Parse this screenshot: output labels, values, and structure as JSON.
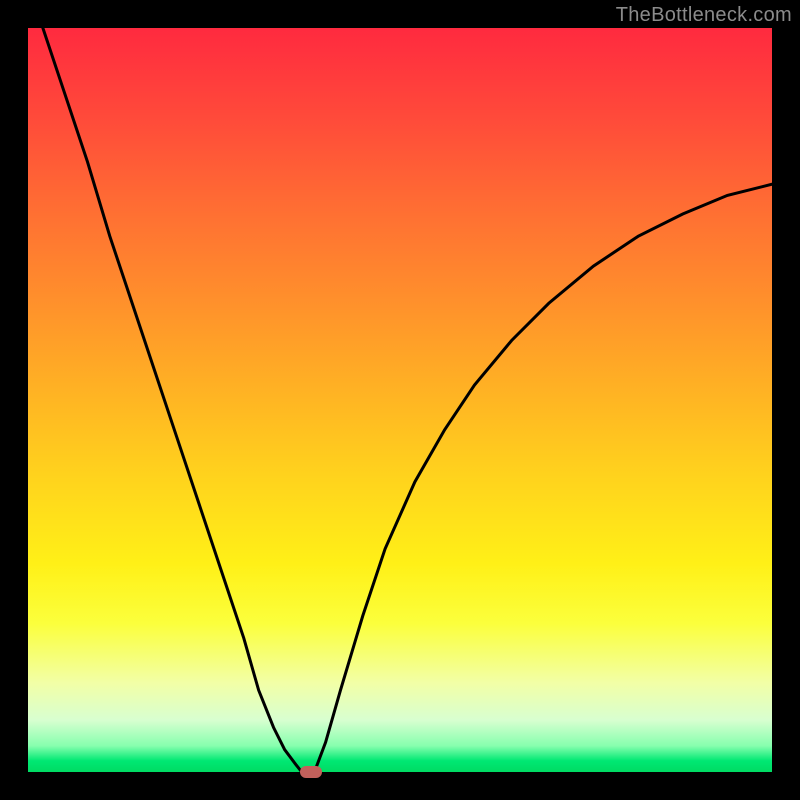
{
  "watermark": "TheBottleneck.com",
  "chart_data": {
    "type": "line",
    "title": "",
    "xlabel": "",
    "ylabel": "",
    "xlim": [
      0,
      100
    ],
    "ylim": [
      0,
      100
    ],
    "series": [
      {
        "name": "left-branch",
        "x": [
          2,
          5,
          8,
          11,
          14,
          17,
          20,
          23,
          26,
          29,
          31,
          33,
          34.5,
          36,
          36.8
        ],
        "y": [
          100,
          91,
          82,
          72,
          63,
          54,
          45,
          36,
          27,
          18,
          11,
          6,
          3,
          1,
          0
        ]
      },
      {
        "name": "right-branch",
        "x": [
          38.5,
          40,
          42,
          45,
          48,
          52,
          56,
          60,
          65,
          70,
          76,
          82,
          88,
          94,
          100
        ],
        "y": [
          0,
          4,
          11,
          21,
          30,
          39,
          46,
          52,
          58,
          63,
          68,
          72,
          75,
          77.5,
          79
        ]
      },
      {
        "name": "valley-flat",
        "x": [
          36.8,
          38.5
        ],
        "y": [
          0,
          0
        ]
      }
    ],
    "marker": {
      "x": 38,
      "y": 0,
      "color": "#c1605b"
    },
    "background_gradient": {
      "top": "#ff2a3f",
      "mid": "#ffd21d",
      "bottom": "#00db63"
    }
  }
}
